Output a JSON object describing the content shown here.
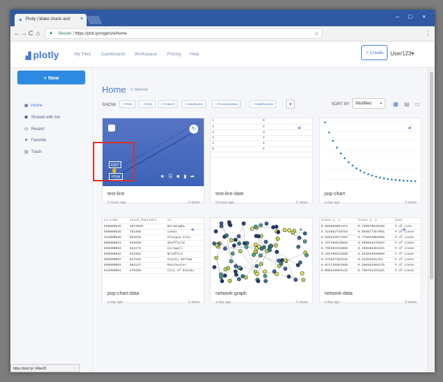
{
  "browser": {
    "tab_title": "Plotly | Make charts and",
    "tab_close": "×",
    "window_controls": [
      "–",
      "□",
      "×"
    ],
    "nav": [
      "←",
      "→",
      "C",
      "⌂"
    ],
    "url_secure": "Secure",
    "url": "https://plot.ly/organize/home",
    "star": "☆",
    "menu": "⋮",
    "status_url": "https://plot.ly/~Allan/5"
  },
  "header": {
    "logo": "plotly",
    "nav": [
      "My Files",
      "Dashboards",
      "Workspace",
      "Pricing",
      "Help"
    ],
    "create": "+ Create",
    "user": "User123▾"
  },
  "sidebar": {
    "new_button": "+ New",
    "items": [
      {
        "icon": "home-icon",
        "glyph": "▣",
        "label": "Home"
      },
      {
        "icon": "shared-icon",
        "glyph": "☗",
        "label": "Shared with me"
      },
      {
        "icon": "recent-icon",
        "glyph": "◷",
        "label": "Recent"
      },
      {
        "icon": "favorite-icon",
        "glyph": "★",
        "label": "Favorite"
      },
      {
        "icon": "trash-icon",
        "glyph": "▥",
        "label": "Trash"
      }
    ]
  },
  "main": {
    "title": "Home",
    "refresh": "Refresh",
    "show_label": "SHOW",
    "filters": [
      "+ Plots",
      "+ Grids",
      "+ Folders",
      "+ Notebooks",
      "+ Presentations",
      "+ Dashboards"
    ],
    "filter_dropdown": "▾",
    "sort_label": "SORT BY",
    "sort_value": "Modified",
    "sort_caret": "▾",
    "view_icons": [
      "▦",
      "▤",
      "▭"
    ]
  },
  "cards": [
    {
      "name": "test-line",
      "meta": "5 hours ago",
      "views": "0 views",
      "edit": "EDIT",
      "view": "VIEW",
      "actions": "★ ⎘ ■ ▮ ➦",
      "share_glyph": "↻"
    },
    {
      "name": "test-line-date",
      "meta": "5 hours ago",
      "views": "0 views",
      "table": [
        [
          "A",
          "B"
        ],
        [
          "1",
          "2"
        ],
        [
          "2",
          "3"
        ],
        [
          "3",
          "4"
        ],
        [
          "4",
          "5"
        ],
        [
          "5",
          "6"
        ],
        [
          "",
          ""
        ]
      ]
    },
    {
      "name": "pop-chart",
      "meta": "a day ago",
      "views": "0 views"
    },
    {
      "name": "pop-chart-data",
      "meta": "a day ago",
      "views": "0 views",
      "table": [
        [
          "LA_code",
          "Total_Populati",
          "LA"
        ],
        [
          "E08000025",
          "1073045",
          "Birmingha"
        ],
        [
          "E08000035",
          "751485",
          "Leeds"
        ],
        [
          "S12000046",
          "593245",
          "Glasgow City"
        ],
        [
          "E08000019",
          "552698",
          "Sheffield"
        ],
        [
          "E06000052",
          "532273",
          "Cornwall"
        ],
        [
          "E08000032",
          "522452",
          "Bradford"
        ],
        [
          "E08000007",
          "517232",
          "County Durham"
        ],
        [
          "E08000003",
          "503127",
          "Manchester"
        ],
        [
          "E12000001",
          "470456",
          "City of Edinbu"
        ]
      ]
    },
    {
      "name": "network-graph",
      "meta": "a day ago",
      "views": "0 views"
    },
    {
      "name": "network-data",
      "meta": "a day ago",
      "views": "0 views",
      "table": [
        [
          "Trace 1, x",
          "Trace 1, y",
          "text"
        ],
        [
          "0.895858061413",
          "0.739970838492",
          "# of conn"
        ],
        [
          "0.424962748763",
          "0.955877357901",
          "# of conne"
        ],
        [
          "0.588124877487",
          "0.775844886955",
          "# of conne"
        ],
        [
          "0.797488816583",
          "0.996863276287",
          "# of conne"
        ],
        [
          "0.705353333655",
          "0.296589481321",
          "# of conne"
        ],
        [
          "0.101790523668",
          "0.254983036856",
          "# of conne"
        ],
        [
          "0.476327363245",
          "0.23201541154",
          "# of conne"
        ],
        [
          "0.074729962685",
          "0.200383969175",
          "# of conne"
        ],
        [
          "0.006349954131",
          "0.786751181321",
          "# of conne"
        ]
      ]
    }
  ],
  "colors": {
    "accent": "#447adb",
    "new_button": "#2d8ae3",
    "titlebar": "#2f59a3",
    "highlight": "#d9302b"
  }
}
